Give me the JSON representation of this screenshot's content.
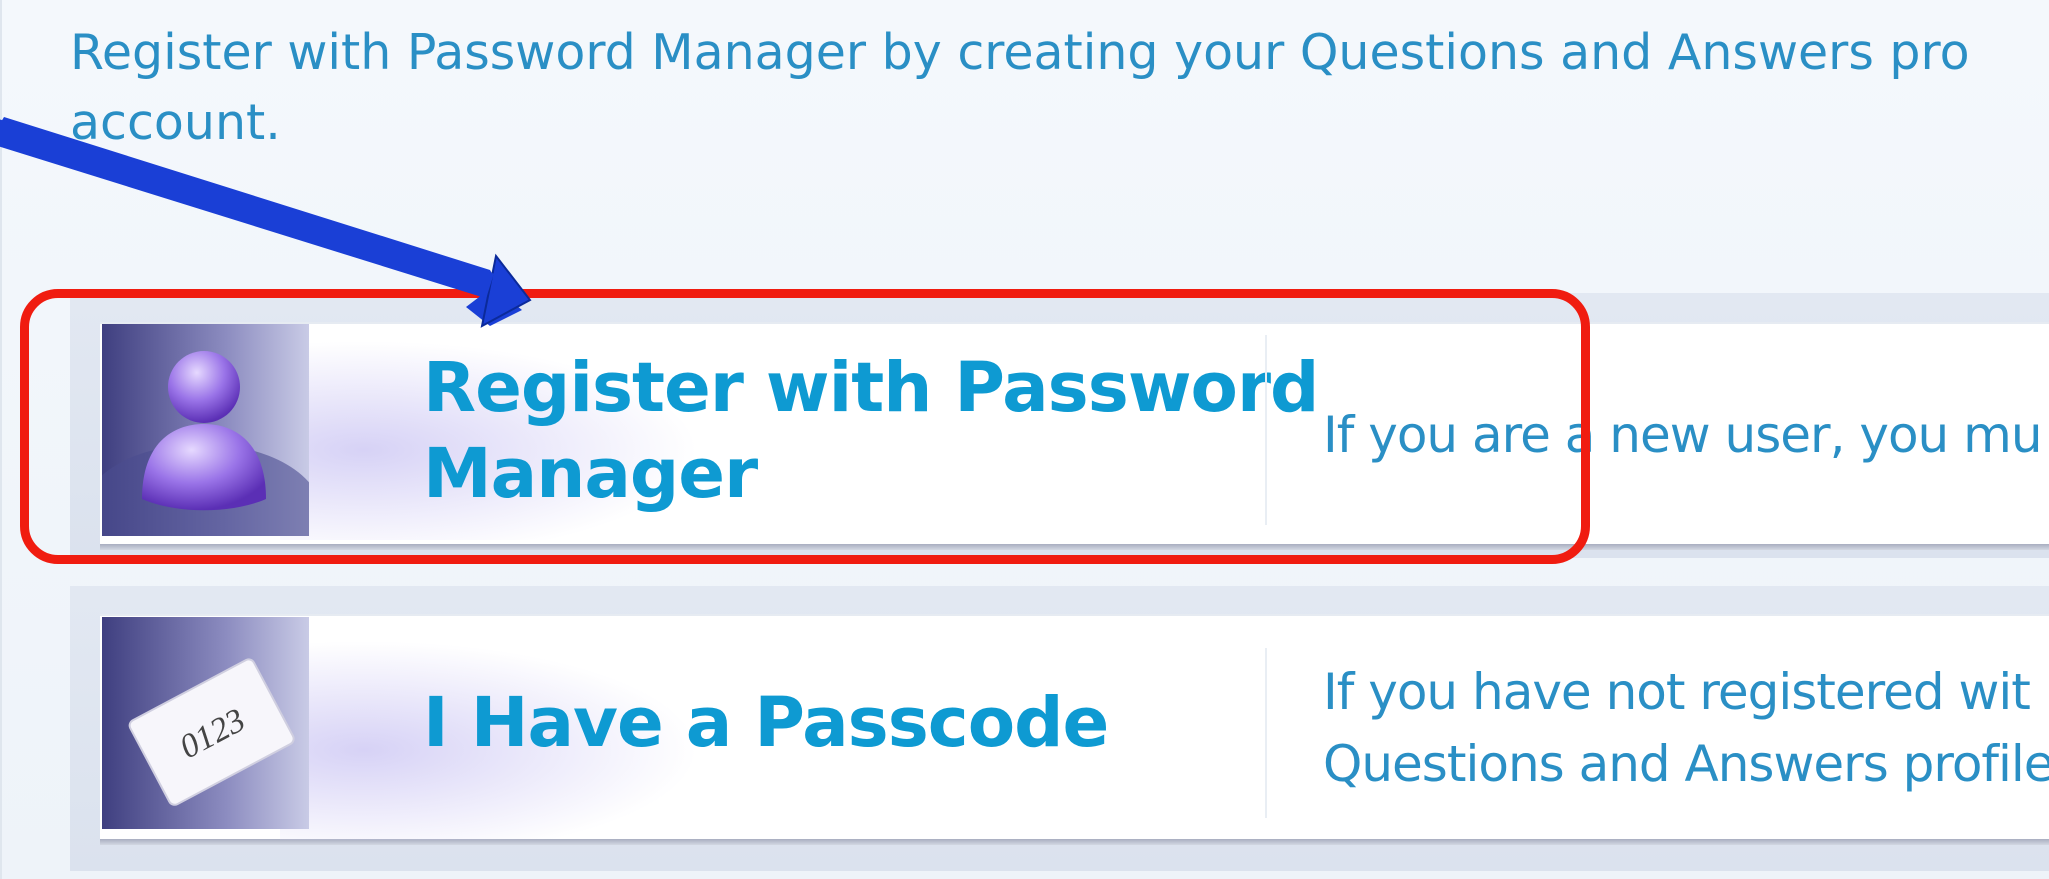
{
  "intro": {
    "text": "Register with Password Manager by creating your Questions and Answers pro account."
  },
  "options": [
    {
      "title": "Register with Password Manager",
      "description": "If you are a new user, you mu",
      "icon": "user-icon"
    },
    {
      "title": "I Have a Passcode",
      "description_line1": "If you have not registered wit",
      "description_line2": "Questions and Answers profile",
      "icon": "passcode-card-icon",
      "icon_text": "0123"
    }
  ],
  "annotation": {
    "highlight_color": "#f01c10",
    "arrow_color": "#1a3fd6"
  }
}
